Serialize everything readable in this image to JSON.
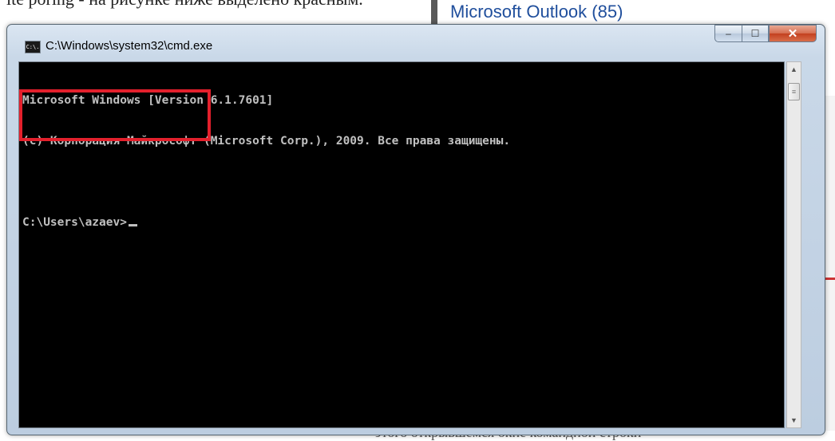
{
  "background": {
    "doc_text_fragment": "ite poring - на рисунке ниже выделено красным.",
    "outlook_label": "Microsoft Outlook (85)",
    "bottom_text_fragment": "этого открывшемся окне командной строки"
  },
  "window": {
    "title": "C:\\Windows\\system32\\cmd.exe",
    "icon_text": "C:\\.",
    "controls": {
      "minimize": "–",
      "maximize": "☐",
      "close": "✕"
    }
  },
  "console": {
    "lines": [
      "Microsoft Windows [Version 6.1.7601]",
      "(c) Корпорация Майкрософт (Microsoft Corp.), 2009. Все права защищены.",
      "",
      "C:\\Users\\azaev>"
    ]
  },
  "scrollbar": {
    "up_arrow": "▲",
    "down_arrow": "▼",
    "thumb_grip": "≡"
  },
  "colors": {
    "highlight": "#e3202c",
    "console_bg": "#000000",
    "console_fg": "#c0c0c0"
  }
}
